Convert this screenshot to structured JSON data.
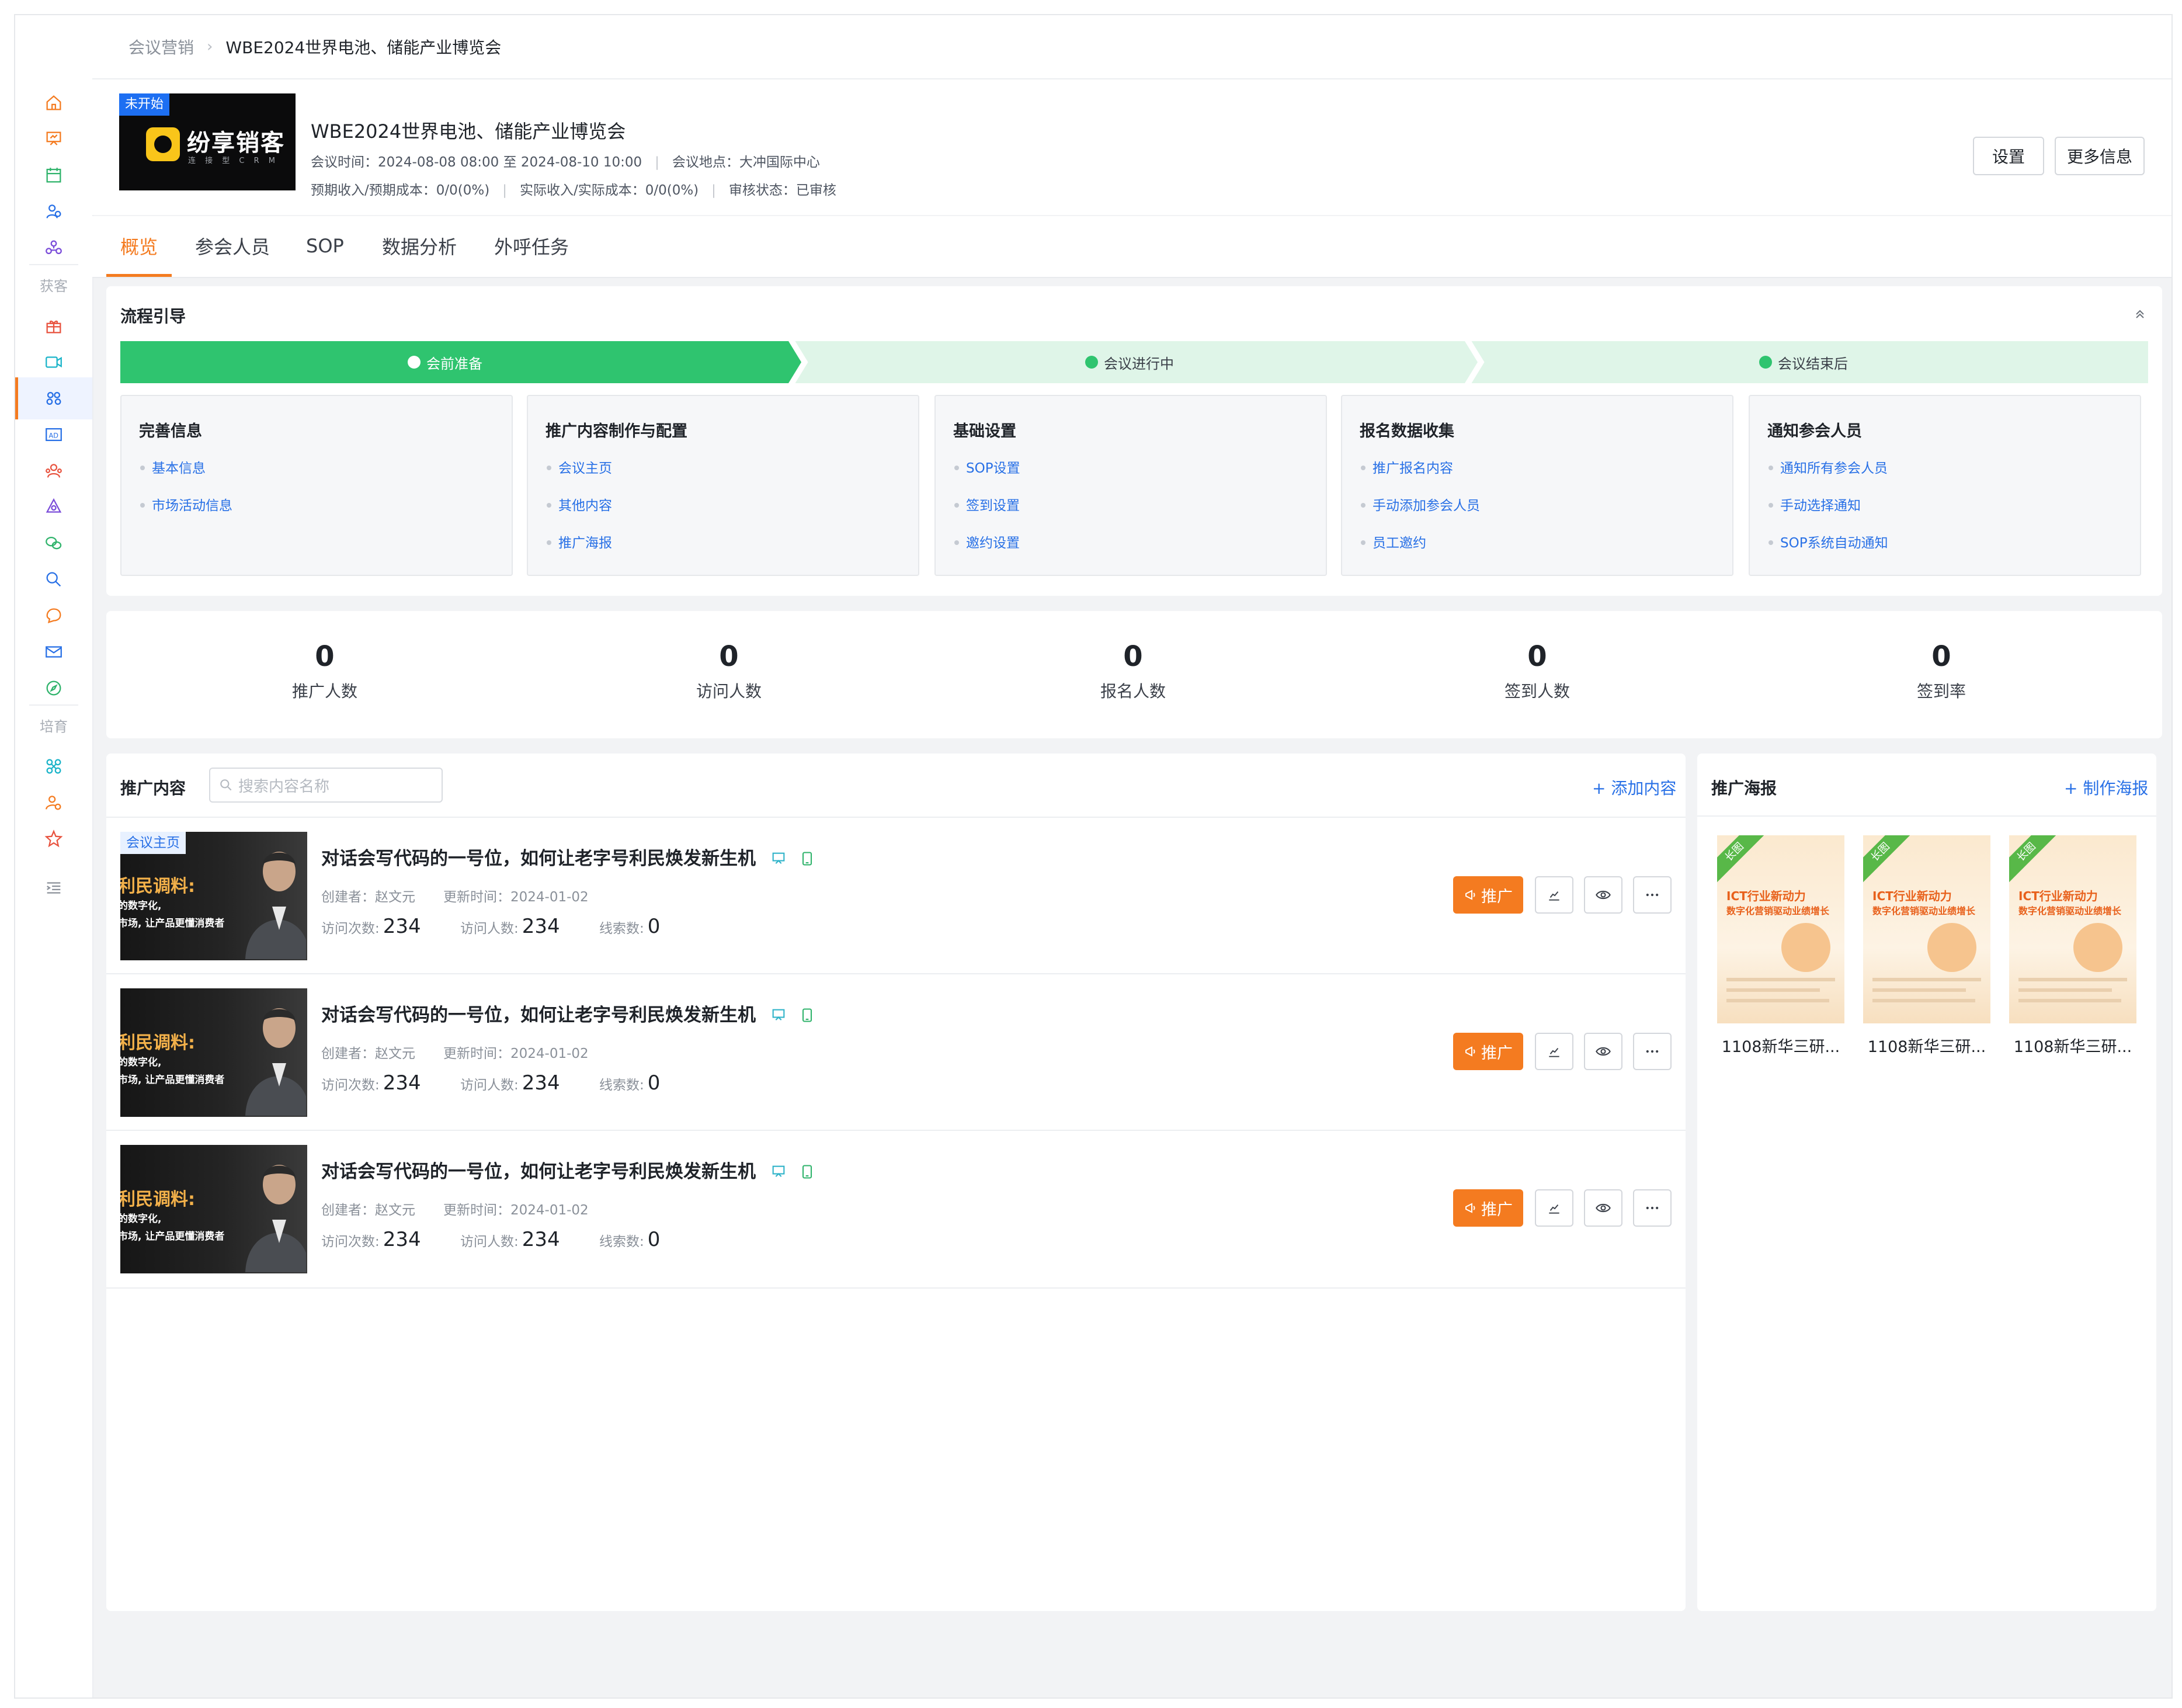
{
  "breadcrumb": {
    "parent": "会议营销",
    "current": "WBE2024世界电池、储能产业博览会"
  },
  "sidebar": {
    "section_acquire": "获客",
    "section_nurture": "培育"
  },
  "header": {
    "status_badge": "未开始",
    "logo_text": "纷享销客",
    "logo_sub": "连 接 型 C R M",
    "title": "WBE2024世界电池、储能产业博览会",
    "time_label": "会议时间：",
    "time_value": "2024-08-08 08:00 至 2024-08-10 10:00",
    "location_label": "会议地点：",
    "location_value": "大冲国际中心",
    "budget_label": "预期收入/预期成本：",
    "budget_value": "0/0(0%)",
    "actual_label": "实际收入/实际成本：",
    "actual_value": "0/0(0%)",
    "review_label": "审核状态：",
    "review_value": "已审核",
    "settings_btn": "设置",
    "more_btn": "更多信息"
  },
  "tabs": [
    "概览",
    "参会人员",
    "SOP",
    "数据分析",
    "外呼任务"
  ],
  "flow": {
    "title": "流程引导",
    "stages": [
      "会前准备",
      "会议进行中",
      "会议结束后"
    ],
    "steps": [
      {
        "title": "完善信息",
        "links": [
          "基本信息",
          "市场活动信息"
        ]
      },
      {
        "title": "推广内容制作与配置",
        "links": [
          "会议主页",
          "其他内容",
          "推广海报"
        ]
      },
      {
        "title": "基础设置",
        "links": [
          "SOP设置",
          "签到设置",
          "邀约设置"
        ]
      },
      {
        "title": "报名数据收集",
        "links": [
          "推广报名内容",
          "手动添加参会人员",
          "员工邀约"
        ]
      },
      {
        "title": "通知参会人员",
        "links": [
          "通知所有参会人员",
          "手动选择通知",
          "SOP系统自动通知"
        ]
      }
    ]
  },
  "stats": [
    {
      "value": "0",
      "label": "推广人数"
    },
    {
      "value": "0",
      "label": "访问人数"
    },
    {
      "value": "0",
      "label": "报名人数"
    },
    {
      "value": "0",
      "label": "签到人数"
    },
    {
      "value": "0",
      "label": "签到率"
    }
  ],
  "promo": {
    "title": "推广内容",
    "search_placeholder": "搜索内容名称",
    "add_link": "+ 添加内容",
    "thumb_text1": "利民调料:",
    "thumb_text2": "的数字化,",
    "thumb_text3": "市场, 让产品更懂消费者",
    "thumb_badge": "会议主页",
    "promote_btn": "推广",
    "items": [
      {
        "title": "对话会写代码的一号位，如何让老字号利民焕发新生机",
        "creator_label": "创建者：",
        "creator": "赵文元",
        "updated_label": "更新时间：",
        "updated": "2024-01-02",
        "visits_label": "访问次数:",
        "visits": "234",
        "visitors_label": "访问人数:",
        "visitors": "234",
        "leads_label": "线索数:",
        "leads": "0",
        "badge": true
      },
      {
        "title": "对话会写代码的一号位，如何让老字号利民焕发新生机",
        "creator_label": "创建者：",
        "creator": "赵文元",
        "updated_label": "更新时间：",
        "updated": "2024-01-02",
        "visits_label": "访问次数:",
        "visits": "234",
        "visitors_label": "访问人数:",
        "visitors": "234",
        "leads_label": "线索数:",
        "leads": "0",
        "badge": false
      },
      {
        "title": "对话会写代码的一号位，如何让老字号利民焕发新生机",
        "creator_label": "创建者：",
        "creator": "赵文元",
        "updated_label": "更新时间：",
        "updated": "2024-01-02",
        "visits_label": "访问次数:",
        "visits": "234",
        "visitors_label": "访问人数:",
        "visitors": "234",
        "leads_label": "线索数:",
        "leads": "0",
        "badge": false
      }
    ]
  },
  "posters": {
    "title": "推广海报",
    "add_link": "+ 制作海报",
    "poster_ribbon": "长图",
    "poster_line1": "ICT行业新动力",
    "poster_line2": "数字化营销驱动业绩增长",
    "items": [
      {
        "name": "1108新华三研..."
      },
      {
        "name": "1108新华三研..."
      },
      {
        "name": "1108新华三研..."
      }
    ]
  },
  "colors": {
    "accent": "#f47b20",
    "link": "#2870e6",
    "stage_active": "#2fc46f",
    "stage_inactive": "#dff5e8"
  }
}
